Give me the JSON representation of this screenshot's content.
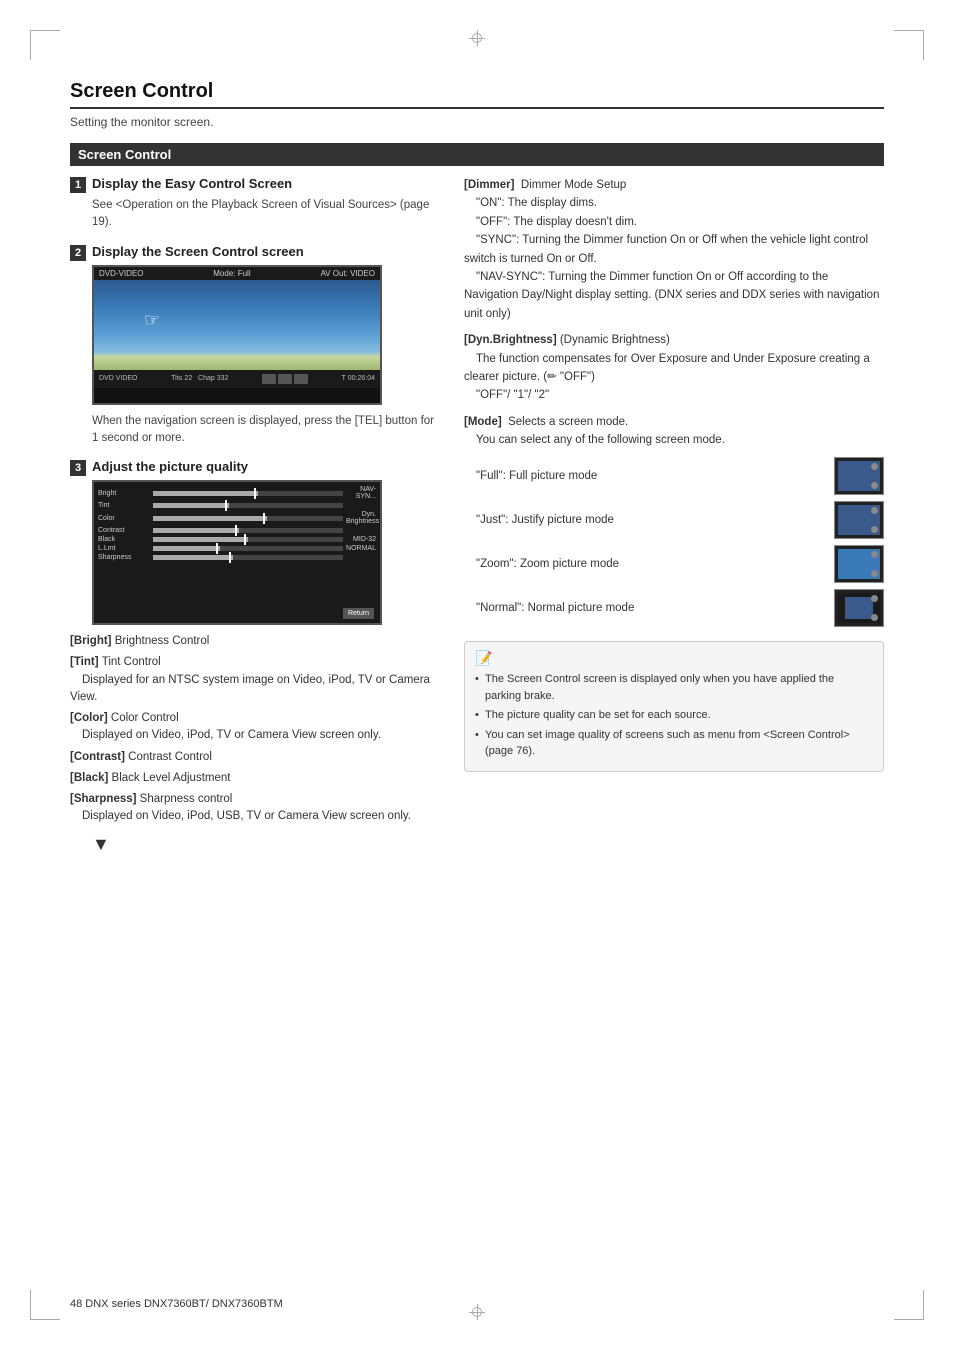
{
  "page": {
    "title": "Screen Control",
    "subtitle": "Setting the monitor screen.",
    "section_label": "Screen Control",
    "footer": "48   DNX series  DNX7360BT/ DNX7360BTM"
  },
  "steps": [
    {
      "num": "1",
      "label": "Display the Easy Control Screen",
      "desc": "See <Operation on the Playback Screen of Visual Sources> (page 19)."
    },
    {
      "num": "2",
      "label": "Display the Screen Control screen",
      "desc_note": "When the navigation screen is displayed, press the [TEL] button for 1 second or more."
    },
    {
      "num": "3",
      "label": "Adjust the picture quality",
      "desc": ""
    }
  ],
  "screen_top_bar": {
    "left": "DVD-VIDEO",
    "middle": "Mode: Full",
    "right": "AV Out: VIDEO"
  },
  "screen_bottom_bar": {
    "left": "DVD VIDEO",
    "middle_1": "Tit-≤ 22",
    "middle_2": "Chap 332",
    "right": "T 00:26:04"
  },
  "adjust_rows": [
    {
      "label": "Bright",
      "fill": 55,
      "val": "NAV-SYN..."
    },
    {
      "label": "Tint",
      "fill": 40,
      "val": ""
    },
    {
      "label": "Color",
      "fill": 60,
      "val": "Dyn. Brightness"
    },
    {
      "label": "Contrast",
      "fill": 45,
      "val": ""
    },
    {
      "label": "Black",
      "fill": 50,
      "val": "MID-32"
    },
    {
      "label": "L.Lmt",
      "fill": 35,
      "val": "NORMAL"
    },
    {
      "label": "Sharpness",
      "fill": 42,
      "val": ""
    }
  ],
  "params_left": [
    {
      "key": "[Bright]",
      "value": "Brightness Control"
    },
    {
      "key": "[Tint]",
      "value": "Tint Control\nDisplayed for an NTSC system image on Video, iPod, TV or Camera View."
    },
    {
      "key": "[Color]",
      "value": "Color Control\nDisplayed on Video, iPod, TV or Camera View screen only."
    },
    {
      "key": "[Contrast]",
      "value": "Contrast Control"
    },
    {
      "key": "[Black]",
      "value": "Black Level Adjustment"
    },
    {
      "key": "[Sharpness]",
      "value": "Sharpness control\nDisplayed on Video, iPod, USB, TV or Camera View screen only."
    }
  ],
  "params_right": [
    {
      "key": "[Dimmer]",
      "label": "Dimmer Mode Setup",
      "items": [
        {
          "sub": "\"ON\":",
          "val": "The display dims."
        },
        {
          "sub": "\"OFF\":",
          "val": "The display doesn't dim."
        },
        {
          "sub": "\"SYNC\":",
          "val": "Turning the Dimmer function On or Off when the vehicle light control switch is turned On or Off."
        },
        {
          "sub": "\"NAV-SYNC\":",
          "val": "Turning the Dimmer function On or Off according to the Navigation Day/Night display setting. (DNX series and DDX series with navigation unit only)"
        }
      ]
    },
    {
      "key": "[Dyn.Brightness]",
      "label": "(Dynamic Brightness)",
      "items": [
        {
          "sub": "",
          "val": "The function compensates for Over Exposure and Under Exposure creating a clearer picture. (✏ \"OFF\")"
        },
        {
          "sub": "",
          "val": "\"OFF\"/ \"1\"/ \"2\""
        }
      ]
    },
    {
      "key": "[Mode]",
      "label": "Selects a screen mode.",
      "items": [
        {
          "sub": "",
          "val": "You can select any of the following screen mode."
        }
      ]
    }
  ],
  "modes": [
    {
      "label": "\"Full\": Full picture mode"
    },
    {
      "label": "\"Just\": Justify picture mode"
    },
    {
      "label": "\"Zoom\": Zoom picture mode"
    },
    {
      "label": "\"Normal\": Normal picture mode"
    }
  ],
  "notes": [
    "The Screen Control screen is displayed only when you have applied the parking brake.",
    "The picture quality can be set for each source.",
    "You can set image quality of screens such as menu from <Screen Control> (page 76)."
  ]
}
